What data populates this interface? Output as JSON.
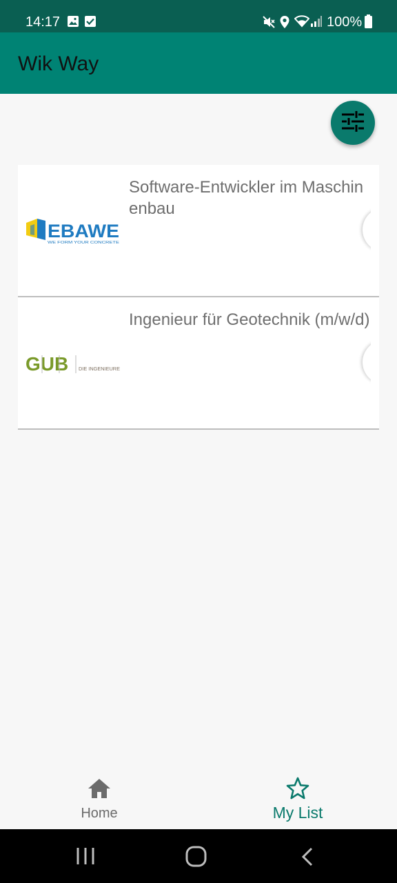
{
  "status_bar": {
    "time": "14:17",
    "battery": "100%",
    "icons": [
      "image-icon",
      "check-box-icon",
      "mute-icon",
      "location-icon",
      "wifi-icon",
      "signal-icon",
      "battery-icon"
    ]
  },
  "app_bar": {
    "title": "Wik Way"
  },
  "fab": {
    "icon": "tune-icon"
  },
  "jobs": [
    {
      "title": "Software-Entwickler im Maschinenbau",
      "logo_text": "EBAWE",
      "logo_tagline": "WE FORM YOUR CONCRETE"
    },
    {
      "title": "Ingenieur für Geotechnik (m/w/d)",
      "logo_text": "GUB",
      "logo_tagline": "DIE INGENIEURE"
    }
  ],
  "bottom_nav": {
    "items": [
      {
        "label": "Home",
        "icon": "home-icon",
        "active": false
      },
      {
        "label": "My List",
        "icon": "star-icon",
        "active": true
      }
    ]
  },
  "colors": {
    "status_bar": "#0a5f52",
    "primary": "#008374",
    "accent": "#0a7a6c",
    "background": "#f7f7f7"
  }
}
